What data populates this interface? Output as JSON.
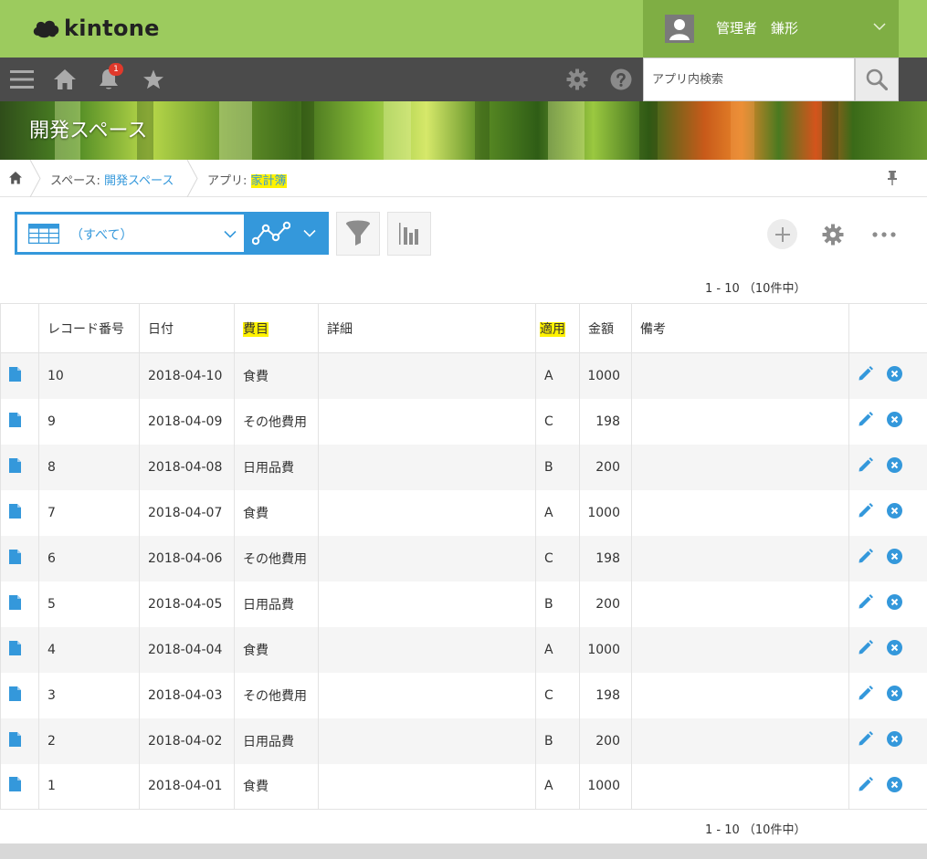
{
  "app": {
    "logo_text": "kintone",
    "user_name": "管理者　鎌形",
    "notification_count": "1"
  },
  "search": {
    "placeholder": "アプリ内検索"
  },
  "banner": {
    "title": "開発スペース"
  },
  "breadcrumb": {
    "space_prefix": "スペース: ",
    "space_name": "開発スペース",
    "app_prefix": "アプリ: ",
    "app_name": "家計簿"
  },
  "view": {
    "selected": "（すべて）"
  },
  "pager": {
    "text": "1 - 10 （10件中）"
  },
  "table": {
    "headers": {
      "record_no": "レコード番号",
      "date": "日付",
      "category": "費目",
      "detail": "詳細",
      "type": "適用",
      "amount": "金額",
      "note": "備考"
    },
    "rows": [
      {
        "record_no": "10",
        "date": "2018-04-10",
        "category": "食費",
        "detail": "",
        "type": "A",
        "amount": "1000",
        "note": ""
      },
      {
        "record_no": "9",
        "date": "2018-04-09",
        "category": "その他費用",
        "detail": "",
        "type": "C",
        "amount": "198",
        "note": ""
      },
      {
        "record_no": "8",
        "date": "2018-04-08",
        "category": "日用品費",
        "detail": "",
        "type": "B",
        "amount": "200",
        "note": ""
      },
      {
        "record_no": "7",
        "date": "2018-04-07",
        "category": "食費",
        "detail": "",
        "type": "A",
        "amount": "1000",
        "note": ""
      },
      {
        "record_no": "6",
        "date": "2018-04-06",
        "category": "その他費用",
        "detail": "",
        "type": "C",
        "amount": "198",
        "note": ""
      },
      {
        "record_no": "5",
        "date": "2018-04-05",
        "category": "日用品費",
        "detail": "",
        "type": "B",
        "amount": "200",
        "note": ""
      },
      {
        "record_no": "4",
        "date": "2018-04-04",
        "category": "食費",
        "detail": "",
        "type": "A",
        "amount": "1000",
        "note": ""
      },
      {
        "record_no": "3",
        "date": "2018-04-03",
        "category": "その他費用",
        "detail": "",
        "type": "C",
        "amount": "198",
        "note": ""
      },
      {
        "record_no": "2",
        "date": "2018-04-02",
        "category": "日用品費",
        "detail": "",
        "type": "B",
        "amount": "200",
        "note": ""
      },
      {
        "record_no": "1",
        "date": "2018-04-01",
        "category": "食費",
        "detail": "",
        "type": "A",
        "amount": "1000",
        "note": ""
      }
    ]
  },
  "colors": {
    "header_green": "#9ccb5e",
    "user_green": "#7fae44",
    "toolbar_gray": "#4b4b4b",
    "accent_blue": "#3498db",
    "highlight_yellow": "#fff200"
  },
  "icons": {
    "menu": "menu-icon",
    "home": "home-icon",
    "notification": "bell-icon",
    "favorite": "star-icon",
    "settings": "gear-icon",
    "help": "help-icon",
    "search": "search-icon",
    "pin": "pin-icon",
    "filter": "filter-icon",
    "graph": "graph-icon",
    "bar_chart": "bar-chart-icon",
    "add": "plus-icon",
    "more": "more-icon",
    "record_detail": "document-icon",
    "edit": "pencil-icon",
    "delete": "delete-icon"
  }
}
